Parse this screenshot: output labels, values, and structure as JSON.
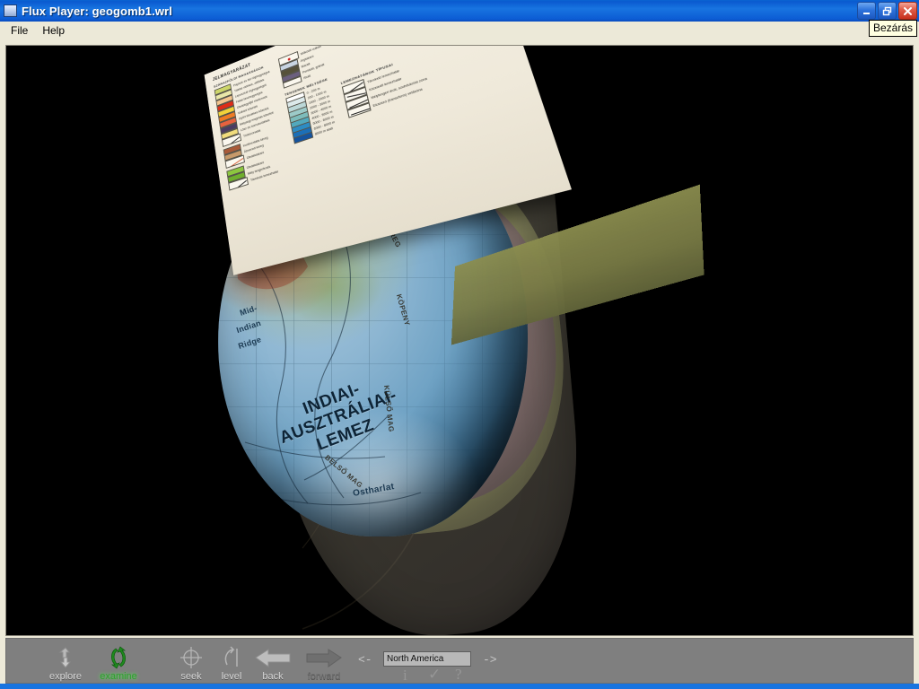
{
  "window": {
    "app_name": "Flux Player",
    "file_name": "geogomb1.wrl",
    "title": "Flux Player: geogomb1.wrl",
    "icon": "app-window-icon",
    "buttons": {
      "minimize": "minimize-button",
      "maximize": "restore-button",
      "close": "close-button"
    },
    "tooltip": "Bezárás"
  },
  "menu": {
    "items": [
      {
        "label": "File"
      },
      {
        "label": "Help"
      }
    ]
  },
  "viewport": {
    "background": "#000000",
    "scene_name": "geogomb1",
    "globe": {
      "plate_label": "INDIAI-\nAUSZTRÁLIAI-\nLEMEZ",
      "plate_label_lines": [
        "INDIAI-",
        "AUSZTRÁLIAI-",
        "LEMEZ"
      ],
      "ocean_labels": [
        "Mid-\nIndian\nRidge",
        "Ostharlat"
      ],
      "ocean_label_1": "Mid-",
      "ocean_label_2": "Indian",
      "ocean_label_3": "Ridge",
      "ocean_label_4": "Ostharlat",
      "layer_labels": [
        "FÖLDKÉREG",
        "KÖPENY",
        "KÜLSŐ MAG",
        "BELSŐ MAG"
      ],
      "colors": {
        "ocean": "#8db6d2",
        "land": "#a0b278",
        "crust_shell": "#8b8f4f",
        "mantle_shell": "#8b6a74",
        "inner_shell": "#8d8f4e",
        "core": "#c25a18",
        "cut_face": "#968e7a"
      }
    },
    "legend_card": {
      "title": "JELMAGYARÁZAT",
      "col1_heading": "SZÁRAZFÖLDI MAGASSÁGOK",
      "col1_entries": [
        {
          "color": "#cdd66a",
          "label": "Pajzsok és ősi röghegységek"
        },
        {
          "color": "#e9e7a8",
          "label": "Táblás vidékek, alföldek"
        },
        {
          "color": "#f2c48e",
          "label": "Lepusztult röghegységek"
        },
        {
          "color": "#df2c17",
          "label": "Fiatal lánchegységek"
        },
        {
          "color": "#f2d23a",
          "label": "Üledékgyűjtő medencék"
        },
        {
          "color": "#ef7b24",
          "label": "Vulkáni kőzetek"
        },
        {
          "color": "#e8623f",
          "label": "Gyűrt üledékes kőzetek"
        },
        {
          "color": "#4b3c63",
          "label": "Mélységi magmás kőzetek"
        },
        {
          "color": "#f0dc7c",
          "label": "Lösz és homokvidékek"
        },
        {
          "color": "#a85a38",
          "label": "Kontinentális kéreg"
        },
        {
          "color": "#c79a6a",
          "label": "Átmeneti kéreg"
        },
        {
          "color": "#f7f2e6",
          "label": "Törésvonalak"
        },
        {
          "color": "#8cc63f",
          "label": "Üledéktakaró"
        },
        {
          "color": "#6fae2e",
          "label": "Mély tengerfenék"
        }
      ],
      "col2_heading": "",
      "col2_entries": [
        {
          "color": "#fbf7ee",
          "label": "Működő vulkán"
        },
        {
          "color": "#c8d4e2",
          "label": "Jégtakaró"
        },
        {
          "color": "#56513a",
          "label": "Bazalt"
        },
        {
          "color": "#6b5f7e",
          "label": "Peridotit, gránát"
        },
        {
          "color": "#fbf7ee",
          "label": "Riolit"
        }
      ],
      "depth_heading": "TENGEREK MÉLYSÉGE",
      "depth_entries": [
        {
          "color": "#ffffff",
          "label": "0 - 200 m"
        },
        {
          "color": "#dce9ea",
          "label": "200 - 1000 m"
        },
        {
          "color": "#bcd8d8",
          "label": "1000 - 2000 m"
        },
        {
          "color": "#9ccac8",
          "label": "2000 - 3000 m"
        },
        {
          "color": "#7dbcbb",
          "label": "3000 - 4000 m"
        },
        {
          "color": "#52a9bd",
          "label": "4000 - 5000 m"
        },
        {
          "color": "#2d8cc4",
          "label": "5000 - 6000 m"
        },
        {
          "color": "#1b6fb8",
          "label": "6000 - 8000 m"
        },
        {
          "color": "#14539f",
          "label": "8000 m alatt"
        }
      ],
      "symbols_heading": "LEMEZHATÁROK TÍPUSAI",
      "symbol_entries": [
        {
          "label": "Távolodó lemezhatár"
        },
        {
          "label": "Közeledő lemezhatár"
        },
        {
          "label": "Mélytengeri árok, szubdukciós zóna"
        },
        {
          "label": "Elcsúszó (transzform) vetőzóna"
        }
      ]
    }
  },
  "toolbar": {
    "modes": [
      {
        "id": "explore",
        "label": "explore",
        "icon": "explore-icon",
        "state": "normal"
      },
      {
        "id": "examine",
        "label": "examine",
        "icon": "examine-icon",
        "state": "active"
      },
      {
        "id": "seek",
        "label": "seek",
        "icon": "seek-icon",
        "state": "normal"
      },
      {
        "id": "level",
        "label": "level",
        "icon": "level-icon",
        "state": "normal"
      },
      {
        "id": "back",
        "label": "back",
        "icon": "back-arrow-icon",
        "state": "normal"
      },
      {
        "id": "forward",
        "label": "forward",
        "icon": "forward-arrow-icon",
        "state": "disabled"
      }
    ],
    "viewpoint": {
      "prev_label": "<-",
      "next_label": "->",
      "value": "North America",
      "placeholder": "Viewpoint"
    },
    "small_icons": [
      {
        "id": "info",
        "label": "i",
        "icon": "info-icon"
      },
      {
        "id": "check",
        "label": "✓",
        "icon": "check-icon"
      },
      {
        "id": "help",
        "label": "?",
        "icon": "question-mark-icon"
      }
    ]
  },
  "colors": {
    "titlebar_blue": "#1874e0",
    "menubar": "#ece9d8",
    "toolbar_gray": "#7f7f7f",
    "active_green": "#2ea02e",
    "viewport_black": "#000000"
  }
}
